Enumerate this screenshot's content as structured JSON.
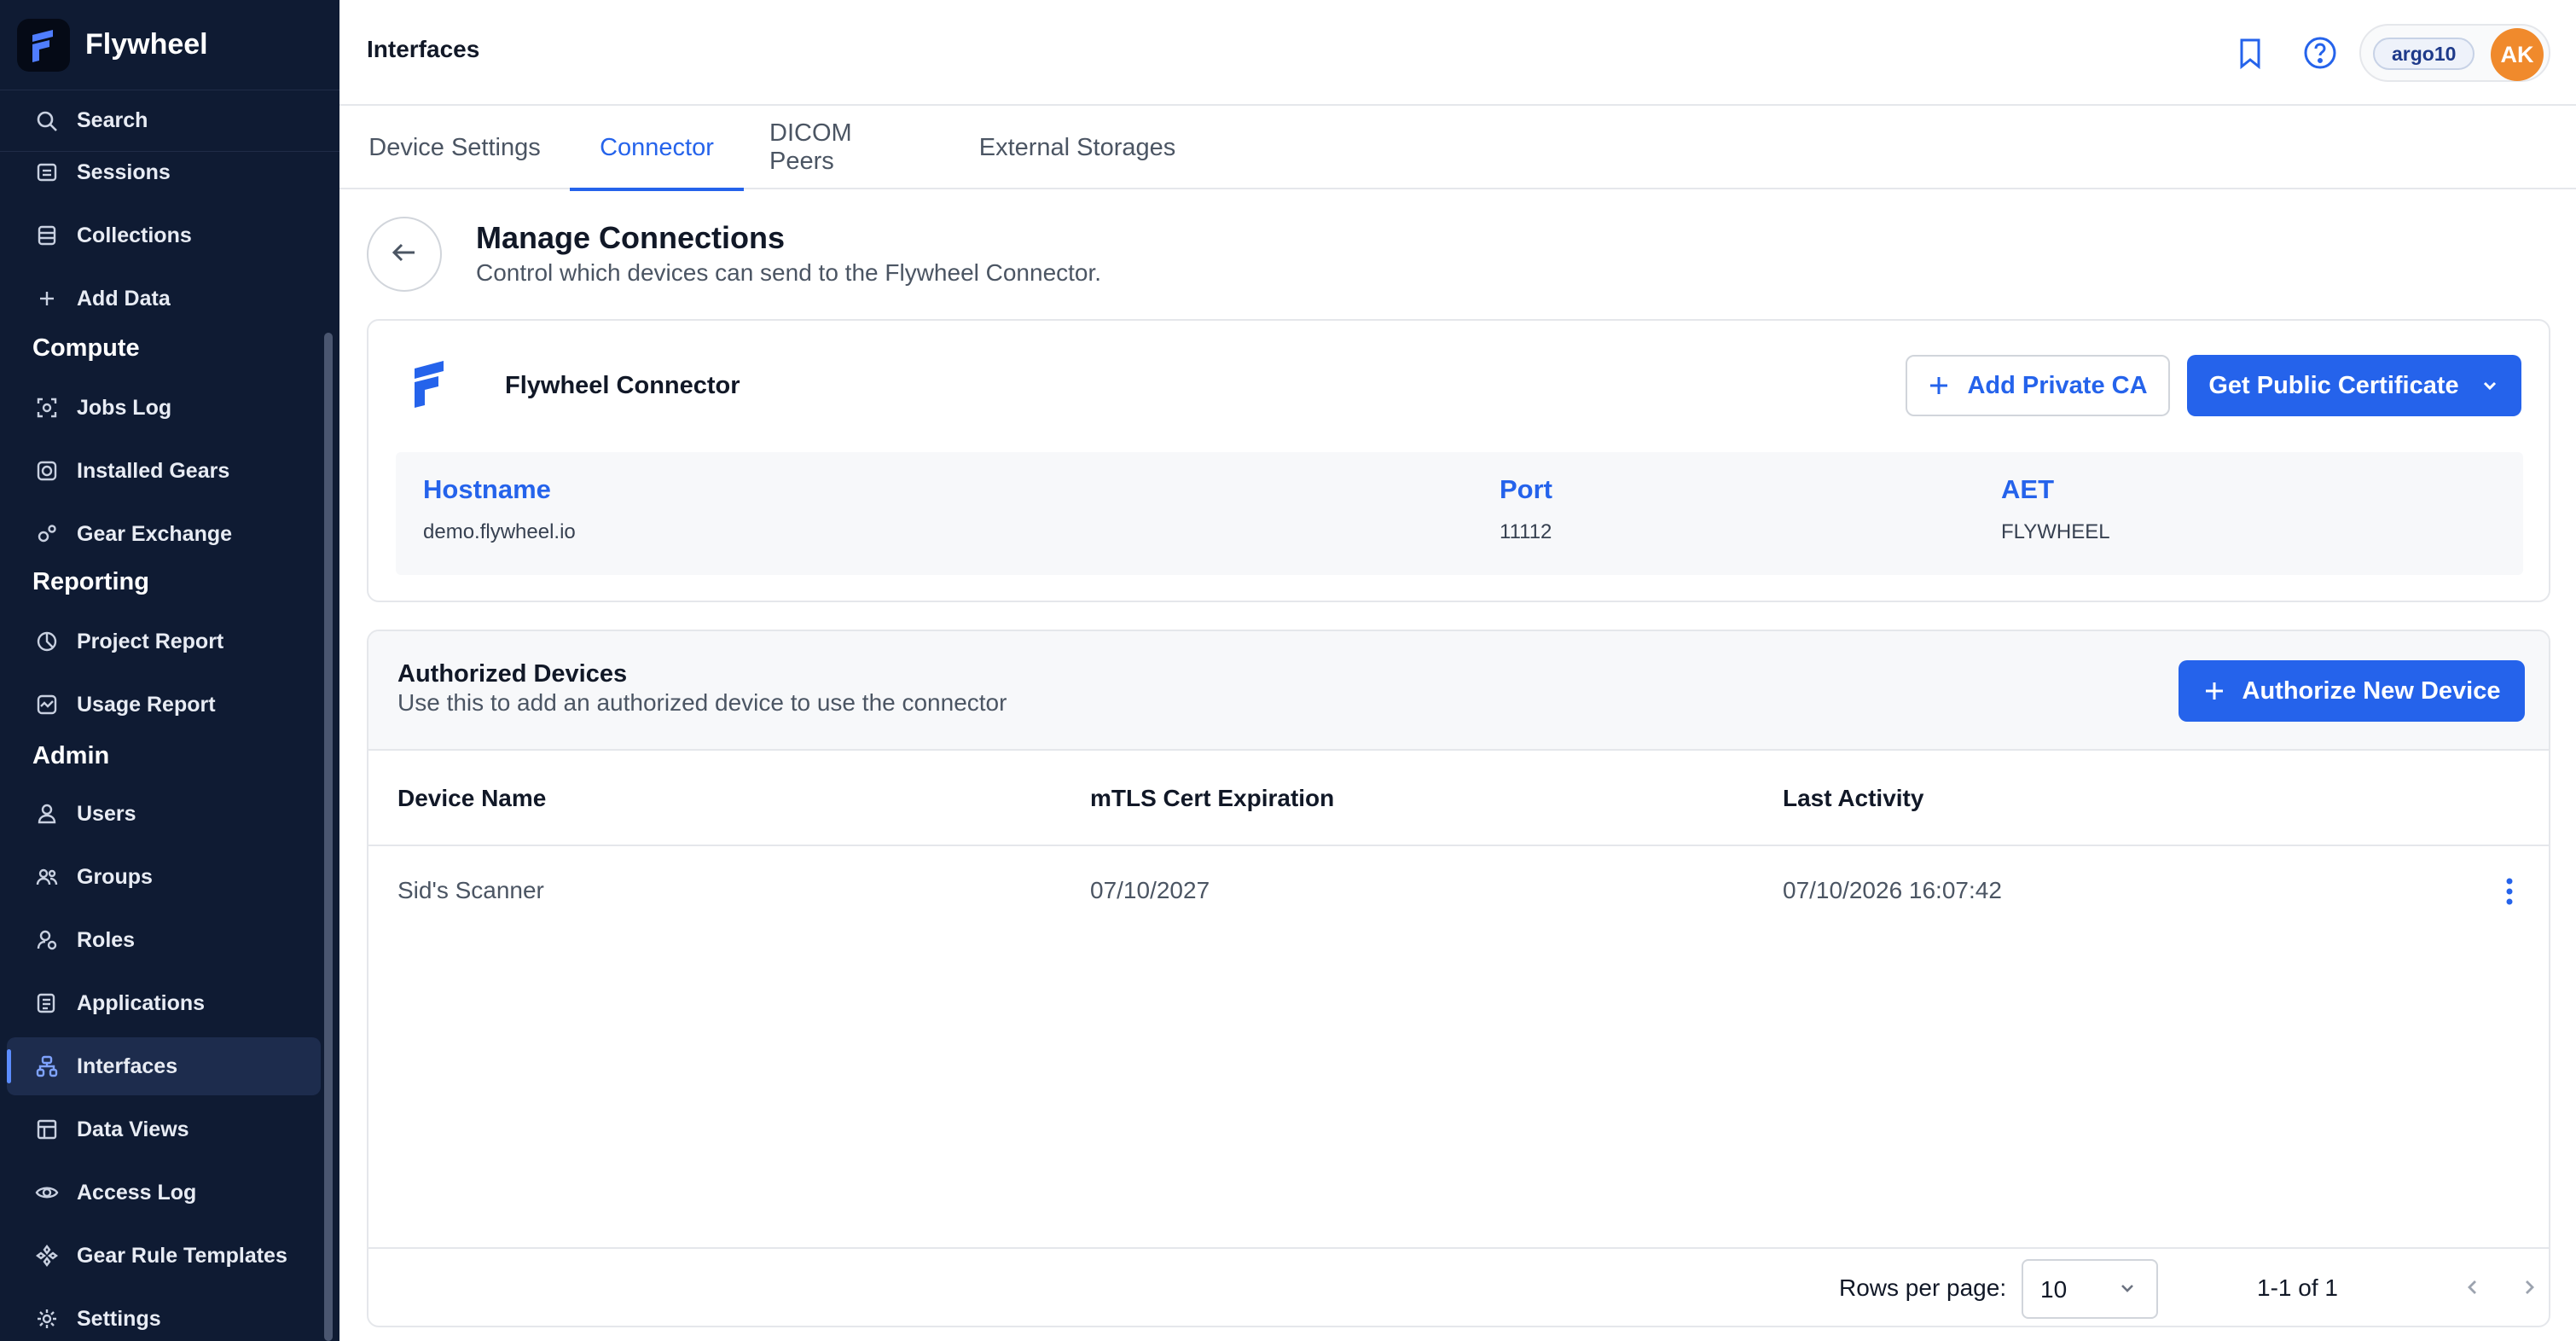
{
  "app": {
    "name": "Flywheel"
  },
  "sidebar": {
    "search_label": "Search",
    "items": [
      {
        "label": "Sessions",
        "icon": "sessions-icon"
      },
      {
        "label": "Collections",
        "icon": "collections-icon"
      },
      {
        "label": "Add Data",
        "icon": "plus-icon"
      }
    ],
    "sections": [
      {
        "title": "Compute",
        "items": [
          {
            "label": "Jobs Log",
            "icon": "jobs-log-icon"
          },
          {
            "label": "Installed Gears",
            "icon": "installed-gears-icon"
          },
          {
            "label": "Gear Exchange",
            "icon": "gear-exchange-icon"
          }
        ]
      },
      {
        "title": "Reporting",
        "items": [
          {
            "label": "Project Report",
            "icon": "project-report-icon"
          },
          {
            "label": "Usage Report",
            "icon": "usage-report-icon"
          }
        ]
      },
      {
        "title": "Admin",
        "items": [
          {
            "label": "Users",
            "icon": "user-icon"
          },
          {
            "label": "Groups",
            "icon": "groups-icon"
          },
          {
            "label": "Roles",
            "icon": "roles-icon"
          },
          {
            "label": "Applications",
            "icon": "applications-icon"
          },
          {
            "label": "Interfaces",
            "icon": "interfaces-icon",
            "active": true
          },
          {
            "label": "Data Views",
            "icon": "data-views-icon"
          },
          {
            "label": "Access Log",
            "icon": "eye-icon"
          },
          {
            "label": "Gear Rule Templates",
            "icon": "gear-rule-templates-icon"
          },
          {
            "label": "Settings",
            "icon": "settings-icon"
          }
        ]
      }
    ]
  },
  "header": {
    "title": "Interfaces",
    "org_badge": "argo10",
    "avatar_initials": "AK",
    "icons": [
      "bookmark-icon",
      "help-icon"
    ]
  },
  "tabs": [
    {
      "label": "Device Settings",
      "active": false
    },
    {
      "label": "Connector",
      "active": true
    },
    {
      "label": "DICOM Peers",
      "active": false
    },
    {
      "label": "External Storages",
      "active": false
    }
  ],
  "manage": {
    "title": "Manage Connections",
    "subtitle": "Control which devices can send to the Flywheel Connector."
  },
  "connector": {
    "name": "Flywheel Connector",
    "add_private_ca": "Add Private CA",
    "get_public_cert": "Get Public Certificate",
    "fields": [
      {
        "label": "Hostname",
        "value": "demo.flywheel.io"
      },
      {
        "label": "Port",
        "value": "11112"
      },
      {
        "label": "AET",
        "value": "FLYWHEEL"
      }
    ]
  },
  "devices": {
    "title": "Authorized Devices",
    "subtitle": "Use this to add an authorized device to use the connector",
    "authorize_button": "Authorize New Device",
    "columns": [
      "Device Name",
      "mTLS Cert Expiration",
      "Last Activity"
    ],
    "rows": [
      {
        "name": "Sid's Scanner",
        "expiration": "07/10/2027",
        "last_activity": "07/10/2026 16:07:42"
      }
    ],
    "pagination": {
      "rows_per_page_label": "Rows per page:",
      "rows_per_page": "10",
      "range": "1-1 of 1"
    }
  },
  "colors": {
    "accent": "#2563eb",
    "sidebar_bg": "#0f1b33",
    "avatar": "#f08a2c"
  }
}
